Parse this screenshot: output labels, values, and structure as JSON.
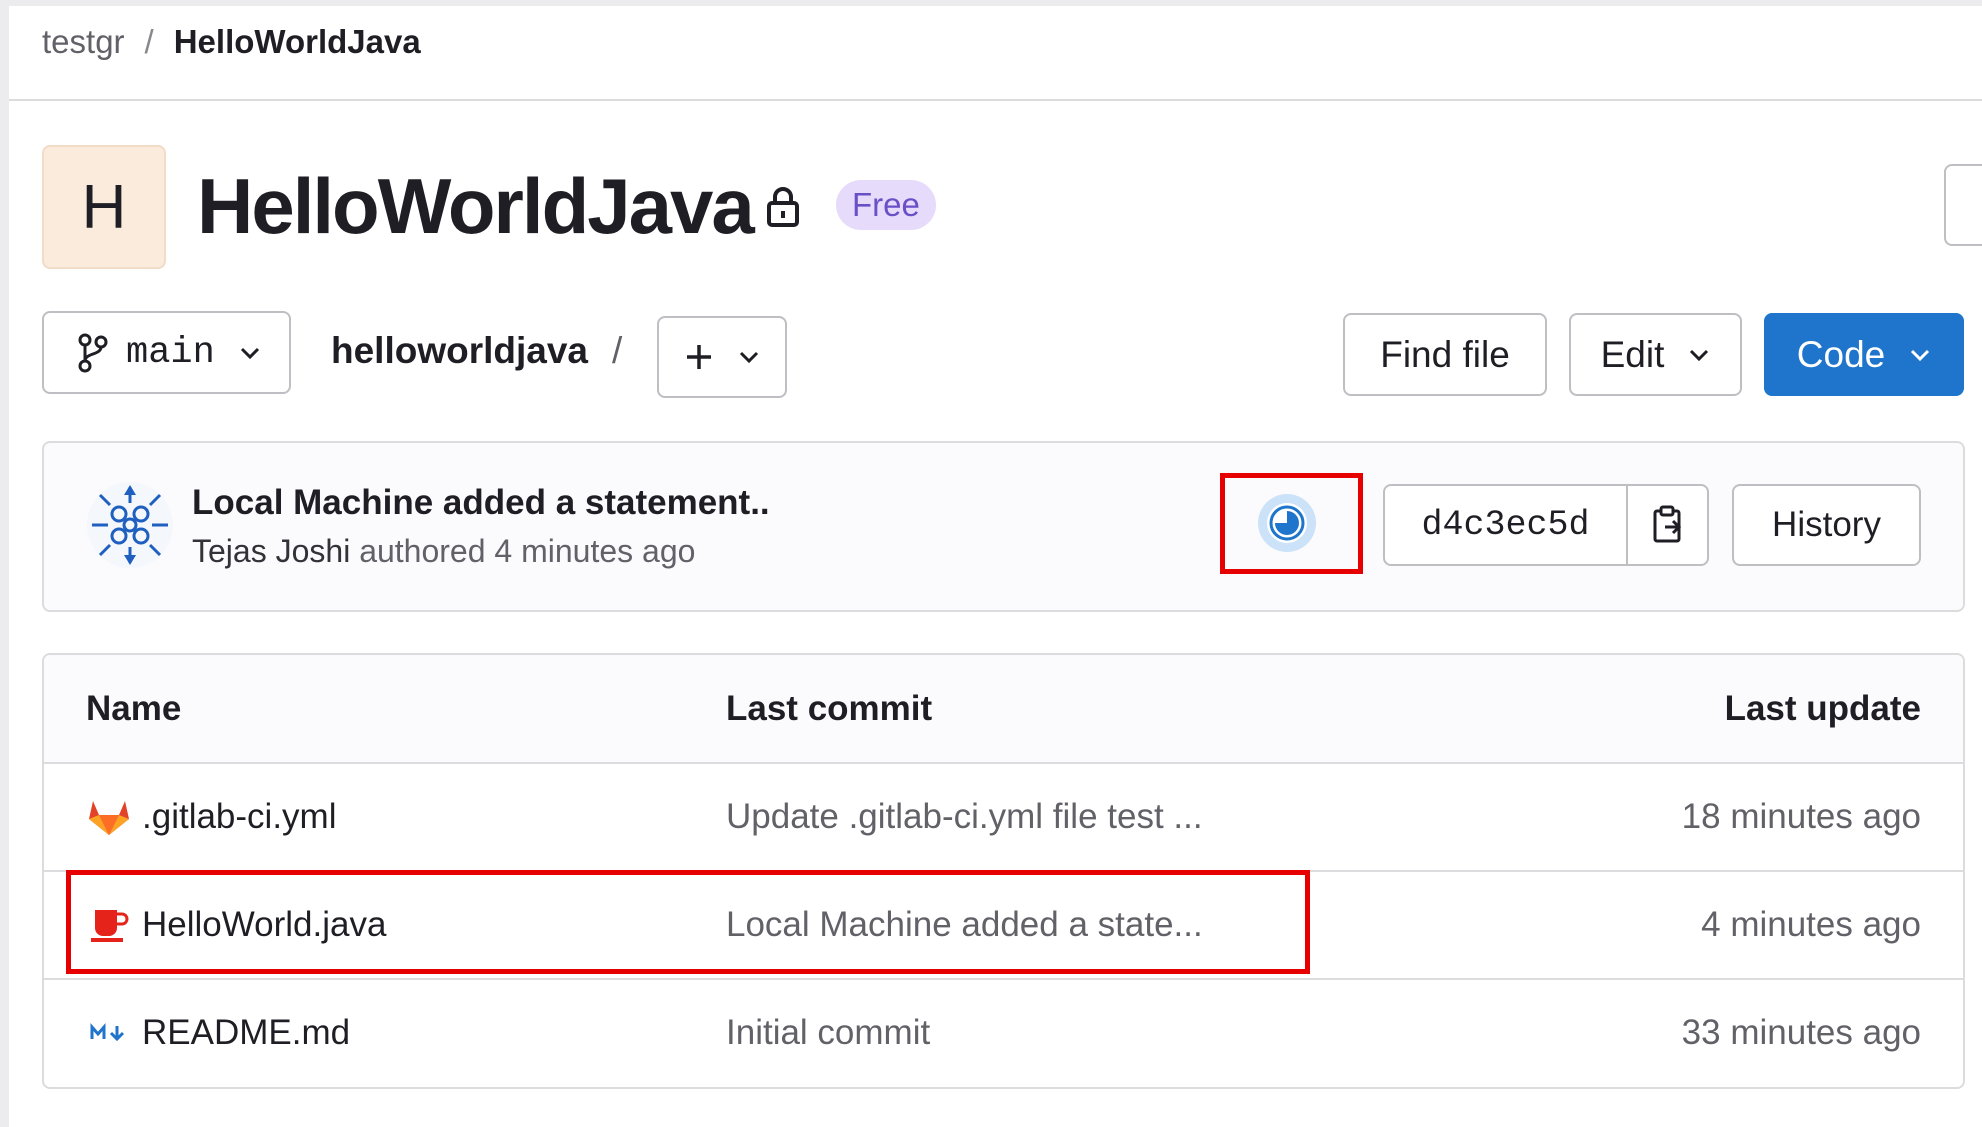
{
  "breadcrumb": {
    "group": "testgr",
    "separator": "/",
    "project": "HelloWorldJava"
  },
  "project": {
    "avatar_letter": "H",
    "title": "HelloWorldJava",
    "visibility_icon": "lock-icon",
    "plan_badge": "Free"
  },
  "toolbar": {
    "branch": "main",
    "path": "helloworldjava",
    "path_separator": "/",
    "add_label": "+",
    "find_file_label": "Find file",
    "edit_label": "Edit",
    "code_label": "Code"
  },
  "last_commit": {
    "title": "Local Machine added a statement..",
    "author": "Tejas Joshi",
    "meta": "authored 4 minutes ago",
    "pipeline_status": "running",
    "sha": "d4c3ec5d",
    "history_label": "History"
  },
  "files": {
    "columns": {
      "name": "Name",
      "last_commit": "Last commit",
      "last_update": "Last update"
    },
    "rows": [
      {
        "icon": "gitlab-icon",
        "name": ".gitlab-ci.yml",
        "commit": "Update .gitlab-ci.yml file test ...",
        "updated": "18 minutes ago"
      },
      {
        "icon": "java-icon",
        "name": "HelloWorld.java",
        "commit": "Local Machine added a state...",
        "updated": "4 minutes ago"
      },
      {
        "icon": "markdown-icon",
        "name": "README.md",
        "commit": "Initial commit",
        "updated": "33 minutes ago"
      }
    ]
  },
  "colors": {
    "primary": "#1f75cb",
    "badge_bg": "#e6dbfa",
    "badge_text": "#6a4fc7",
    "highlight": "#e60000",
    "avatar_bg": "#fbebdc"
  }
}
